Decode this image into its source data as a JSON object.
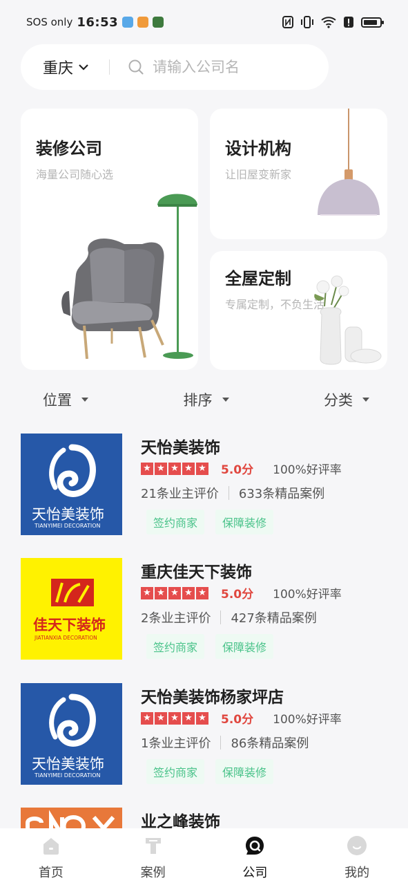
{
  "status_bar": {
    "carrier": "SOS only",
    "time": "16:53",
    "battery_level": 0.85
  },
  "search": {
    "city": "重庆",
    "placeholder": "请输入公司名"
  },
  "categories": [
    {
      "title": "装修公司",
      "subtitle": "海量公司随心选"
    },
    {
      "title": "设计机构",
      "subtitle": "让旧屋变新家"
    },
    {
      "title": "全屋定制",
      "subtitle": "专属定制，不负生活"
    }
  ],
  "filters": [
    {
      "label": "位置"
    },
    {
      "label": "排序"
    },
    {
      "label": "分类"
    }
  ],
  "companies": [
    {
      "name": "天怡美装饰",
      "score": "5.0分",
      "stars": 5,
      "good_rate": "100%好评率",
      "reviews": "21条业主评价",
      "cases": "633条精品案例",
      "tags": [
        "签约商家",
        "保障装修"
      ],
      "logo": {
        "type": "tianyimei",
        "text": "天怡美装饰",
        "en": "TIANYIMEI DECORATION",
        "bg": "#2658a8"
      }
    },
    {
      "name": "重庆佳天下装饰",
      "score": "5.0分",
      "stars": 5,
      "good_rate": "100%好评率",
      "reviews": "2条业主评价",
      "cases": "427条精品案例",
      "tags": [
        "签约商家",
        "保障装修"
      ],
      "logo": {
        "type": "jiatianxia",
        "text": "佳天下装饰",
        "en": "JIATIANXIA DECORATION",
        "bg": "#fff200"
      }
    },
    {
      "name": "天怡美装饰杨家坪店",
      "score": "5.0分",
      "stars": 5,
      "good_rate": "100%好评率",
      "reviews": "1条业主评价",
      "cases": "86条精品案例",
      "tags": [
        "签约商家",
        "保障装修"
      ],
      "logo": {
        "type": "tianyimei",
        "text": "天怡美装饰",
        "en": "TIANYIMEI DECORATION",
        "bg": "#2658a8"
      }
    },
    {
      "name": "业之峰装饰",
      "logo": {
        "type": "yezhifeng",
        "bg": "#e8783a"
      }
    }
  ],
  "tabbar": [
    {
      "label": "首页",
      "icon": "home-icon",
      "active": false
    },
    {
      "label": "案例",
      "icon": "case-icon",
      "active": false
    },
    {
      "label": "公司",
      "icon": "company-icon",
      "active": true
    },
    {
      "label": "我的",
      "icon": "profile-icon",
      "active": false
    }
  ],
  "colors": {
    "accent_red": "#e54d4d",
    "tag_green": "#4ac38a",
    "tag_bg": "#eefaf3",
    "tianyimei_blue": "#2658a8",
    "jiatianxia_yellow": "#fff200"
  }
}
